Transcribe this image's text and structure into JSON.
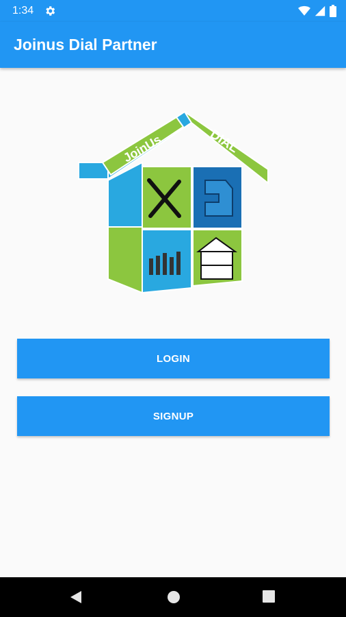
{
  "status_bar": {
    "time": "1:34",
    "icons": [
      "gear-icon",
      "wifi-icon",
      "signal-icon",
      "battery-icon"
    ]
  },
  "app_bar": {
    "title": "Joinus Dial Partner"
  },
  "logo": {
    "left_text": "JoinUs",
    "right_text": "DIAL",
    "colors": {
      "green": "#8cc63f",
      "blue": "#29a8e0",
      "dark_blue": "#1a6fb4"
    }
  },
  "actions": {
    "login_label": "LOGIN",
    "signup_label": "SIGNUP"
  },
  "nav_bar": {
    "icons": [
      "back-icon",
      "home-icon",
      "recents-icon"
    ]
  },
  "theme": {
    "primary": "#2196f3",
    "background": "#fafafa"
  }
}
